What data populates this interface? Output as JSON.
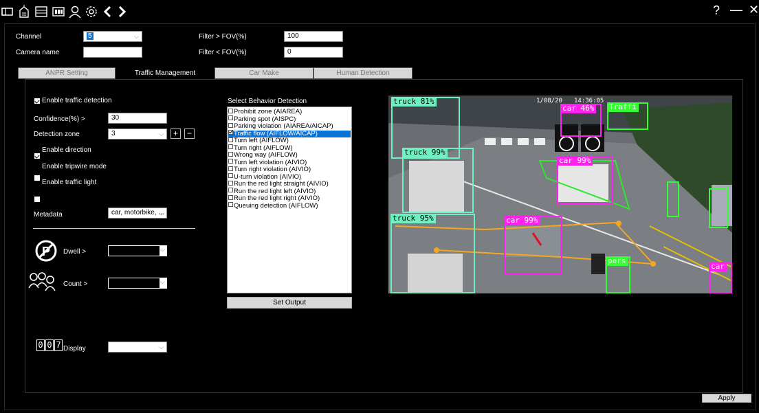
{
  "toolbar": {
    "icons": [
      "window-icon",
      "chip-icon",
      "device-icon",
      "pcb-icon",
      "user-icon",
      "settings-icon",
      "back-icon",
      "forward-icon"
    ],
    "help": "?",
    "minimize": "—",
    "close": "✕"
  },
  "header": {
    "channel_label": "Channel",
    "channel_value": "5",
    "camera_name_label": "Camera name",
    "camera_name_value": "",
    "filter_gt_label": "Filter > FOV(%)",
    "filter_gt_value": "100",
    "filter_lt_label": "Filter < FOV(%)",
    "filter_lt_value": "0"
  },
  "tabs": [
    {
      "label": "ANPR Setting",
      "active": false
    },
    {
      "label": "Traffic Management",
      "active": true
    },
    {
      "label": "Car Make",
      "active": false
    },
    {
      "label": "Human Detection",
      "active": false
    }
  ],
  "left": {
    "enable_traffic_detection": "Enable traffic detection",
    "confidence_label": "Confidence(%) >",
    "confidence_value": "30",
    "detection_zone_label": "Detection zone",
    "detection_zone_value": "3",
    "add": "+",
    "remove": "−",
    "enable_direction": "Enable direction",
    "enable_tripwire": "Enable tripwire mode",
    "enable_traffic_light": "Enable traffic light",
    "metadata_label": "Metadata",
    "metadata_value": "car, motorbike, ...",
    "dwell_label": "Dwell >",
    "count_label": "Count >",
    "display_label": "Display",
    "display_digits": [
      "0",
      "0",
      "7"
    ]
  },
  "behavior": {
    "title": "Select Behavior Detection",
    "items": [
      {
        "label": "Prohibit zone (AIAREA)",
        "checked": false,
        "selected": false
      },
      {
        "label": "Parking spot (AISPC)",
        "checked": false,
        "selected": false
      },
      {
        "label": "Parking violation (AIAREA/AICAP)",
        "checked": false,
        "selected": false
      },
      {
        "label": "Traffic flow (AIFLOW/AICAP)",
        "checked": true,
        "selected": true
      },
      {
        "label": "Turn left (AIFLOW)",
        "checked": false,
        "selected": false
      },
      {
        "label": "Turn right (AIFLOW)",
        "checked": false,
        "selected": false
      },
      {
        "label": "Wrong way (AIFLOW)",
        "checked": false,
        "selected": false
      },
      {
        "label": "Turn left violation (AIVIO)",
        "checked": false,
        "selected": false
      },
      {
        "label": "Turn right violation (AIVIO)",
        "checked": false,
        "selected": false
      },
      {
        "label": "U-turn violation (AIVIO)",
        "checked": false,
        "selected": false
      },
      {
        "label": "Run the red light straight (AIVIO)",
        "checked": false,
        "selected": false
      },
      {
        "label": "Run the red light left (AIVIO)",
        "checked": false,
        "selected": false
      },
      {
        "label": "Run the red light right (AIVIO)",
        "checked": false,
        "selected": false
      },
      {
        "label": "Queuing detection (AIFLOW)",
        "checked": false,
        "selected": false
      }
    ],
    "set_output": "Set Output"
  },
  "camera": {
    "osd_date": "1/08/20",
    "osd_time": "14:36:05",
    "detections": [
      {
        "label": "truck 81%",
        "color": "#6ff0c0"
      },
      {
        "label": "truck 99%",
        "color": "#6ff0c0"
      },
      {
        "label": "truck 95%",
        "color": "#6ff0c0"
      },
      {
        "label": "car 46%",
        "color": "#ff22ee"
      },
      {
        "label": "car 99%",
        "color": "#ff22ee"
      },
      {
        "label": "car 99%",
        "color": "#ff22ee"
      },
      {
        "label": "car",
        "color": "#ff22ee"
      },
      {
        "label": "Traffi",
        "color": "#33ff33"
      },
      {
        "label": "pers",
        "color": "#33ff33"
      }
    ]
  },
  "apply": "Apply",
  "colors": {
    "accent": "#0a73d6",
    "zone": "#2ee82e",
    "flow": "#f5a623"
  }
}
